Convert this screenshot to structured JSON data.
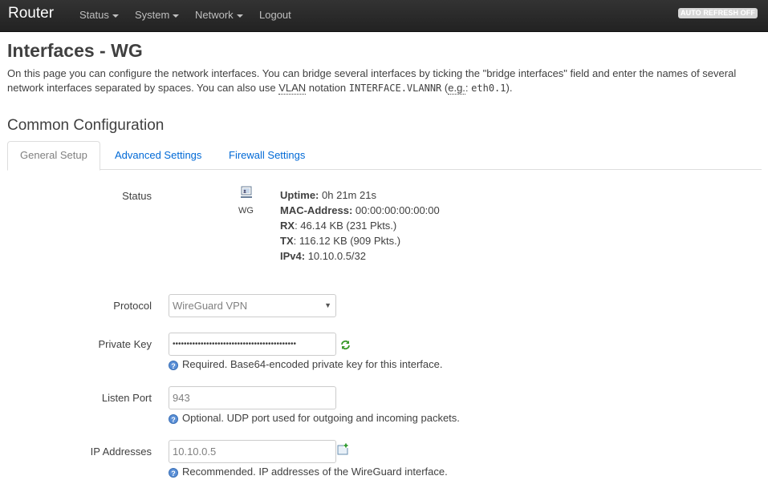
{
  "header": {
    "brand": "Router",
    "nav": [
      {
        "label": "Status",
        "has_menu": true
      },
      {
        "label": "System",
        "has_menu": true
      },
      {
        "label": "Network",
        "has_menu": true
      },
      {
        "label": "Logout",
        "has_menu": false
      }
    ],
    "auto_refresh": "AUTO REFRESH OFF"
  },
  "page": {
    "title": "Interfaces - WG",
    "description": {
      "part1": "On this page you can configure the network interfaces. You can bridge several interfaces by ticking the \"bridge interfaces\" field and enter the names of several network interfaces separated by spaces. You can also use ",
      "vlan": "VLAN",
      "part2": " notation ",
      "code1": "INTERFACE.VLANNR",
      "part3": " (",
      "eg": "e.g.",
      "part4": ": ",
      "code2": "eth0.1",
      "part5": ")."
    }
  },
  "section": {
    "title": "Common Configuration",
    "tabs": [
      "General Setup",
      "Advanced Settings",
      "Firewall Settings"
    ],
    "active_tab": "General Setup"
  },
  "status": {
    "label": "Status",
    "interface": "WG",
    "uptime_label": "Uptime:",
    "uptime": "0h 21m 21s",
    "mac_label": "MAC-Address:",
    "mac": "00:00:00:00:00:00",
    "rx_label": "RX",
    "rx": "46.14 KB (231 Pkts.)",
    "tx_label": "TX",
    "tx": "116.12 KB (909 Pkts.)",
    "ipv4_label": "IPv4:",
    "ipv4": "10.10.0.5/32"
  },
  "fields": {
    "protocol": {
      "label": "Protocol",
      "value": "WireGuard VPN"
    },
    "private_key": {
      "label": "Private Key",
      "value": "••••••••••••••••••••••••••••••••••••••••••••",
      "hint": "Required. Base64-encoded private key for this interface."
    },
    "listen_port": {
      "label": "Listen Port",
      "value": "943",
      "hint": "Optional. UDP port used for outgoing and incoming packets."
    },
    "ip_addresses": {
      "label": "IP Addresses",
      "value": "10.10.0.5",
      "hint": "Recommended. IP addresses of the WireGuard interface."
    }
  },
  "colors": {
    "link": "#0069d6",
    "topbar": "#222222",
    "help": "#5a8fd6"
  }
}
